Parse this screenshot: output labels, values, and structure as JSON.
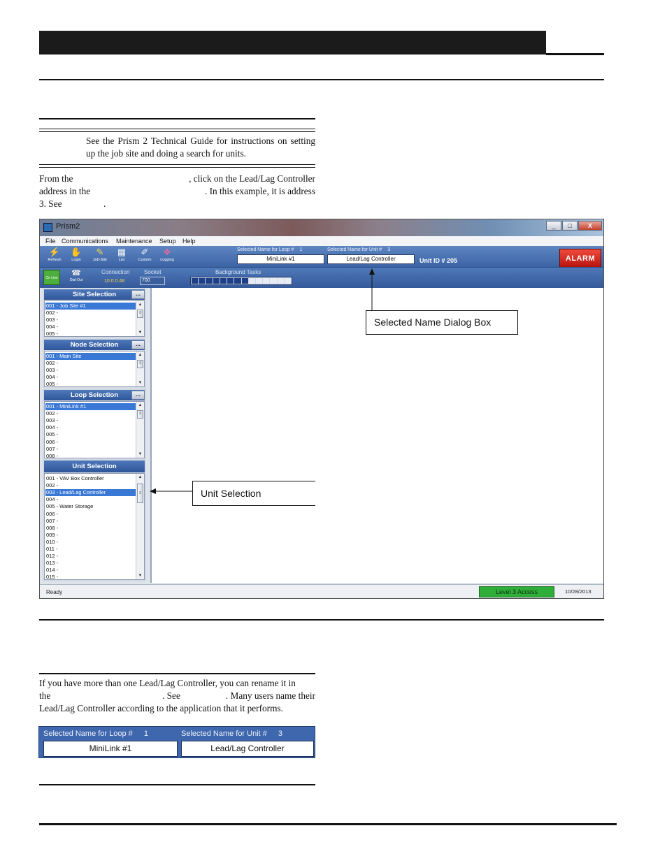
{
  "note": {
    "text": "See the Prism 2 Technical Guide for instructions on setting up the job site and doing a search for units."
  },
  "intro_paragraph": {
    "line1_a": "From the",
    "line1_b": ", click on the Lead/Lag Controller",
    "line2_a": "address in the",
    "line2_b": ". In this example, it is address",
    "line3_a": "3. See",
    "line3_b": "."
  },
  "window": {
    "title": "Prism2",
    "controls": {
      "minimize": "_",
      "maximize": "□",
      "close": "X"
    },
    "menu": [
      "File",
      "Communications",
      "Maintenance",
      "Setup",
      "Help"
    ],
    "toolbar": [
      {
        "label": "Refresh",
        "icon": "refresh-icon",
        "glyph": "⚡"
      },
      {
        "label": "Login",
        "icon": "login-icon",
        "glyph": "✋"
      },
      {
        "label": "Job-Site",
        "icon": "job-site-icon",
        "glyph": "✎"
      },
      {
        "label": "List",
        "icon": "list-icon",
        "glyph": "▦"
      },
      {
        "label": "Custom",
        "icon": "custom-icon",
        "glyph": "✐"
      },
      {
        "label": "Logging",
        "icon": "logging-icon",
        "glyph": "❖"
      }
    ],
    "loop_name_label": "Selected Name for Loop #",
    "loop_number": "1",
    "unit_name_label": "Selected Name for Unit #",
    "unit_number": "3",
    "loop_name_value": "MiniLink #1",
    "unit_name_value": "Lead/Lag Controller",
    "unit_id": "Unit ID # 205",
    "alarm": "ALARM",
    "online": "On Line",
    "dialout": "Dial-Out",
    "connection_label": "Connection",
    "connection_value": "10.0.0.48",
    "socket_label": "Socket",
    "socket_value": "700",
    "background_tasks_label": "Background Tasks",
    "background_tasks_progress": 0.55,
    "sections": {
      "site": {
        "title": "Site Selection",
        "more": "...",
        "items": [
          "001 - Job Site #1",
          "002 -",
          "003 -",
          "004 -",
          "005 -"
        ]
      },
      "node": {
        "title": "Node Selection",
        "more": "...",
        "items": [
          "001 - Main Site",
          "002 -",
          "003 -",
          "004 -",
          "005 -"
        ]
      },
      "loop": {
        "title": "Loop Selection",
        "more": "...",
        "items": [
          "001 - MiniLink #1",
          "002 -",
          "003 -",
          "004 -",
          "005 -",
          "006 -",
          "007 -",
          "008 -"
        ]
      },
      "unit": {
        "title": "Unit Selection",
        "items": [
          "001 - VAV Box Controller",
          "002 -",
          "003 - Lead/Lag Controller",
          "004 -",
          "005 - Water Storage",
          "006 -",
          "007 -",
          "008 -",
          "009 -",
          "010 -",
          "011 -",
          "012 -",
          "013 -",
          "014 -",
          "015 -"
        ]
      }
    },
    "status": {
      "ready": "Ready",
      "access": "Level 3 Access",
      "date": "10/28/2013"
    }
  },
  "callouts": {
    "selected_name": "Selected Name Dialog Box",
    "unit_selection": "Unit Selection"
  },
  "rename_paragraph": {
    "line1": "If you have more than one Lead/Lag Controller, you can rename it in",
    "line2_a": "the",
    "line2_b": ". See",
    "line2_c": ". Many users name their",
    "line3": "Lead/Lag Controller according to the application that it performs."
  },
  "snippet": {
    "loop_label": "Selected Name for Loop #",
    "loop_number": "1",
    "unit_label": "Selected Name for Unit #",
    "unit_number": "3",
    "loop_value": "MiniLink #1",
    "unit_value": "Lead/Lag Controller"
  }
}
